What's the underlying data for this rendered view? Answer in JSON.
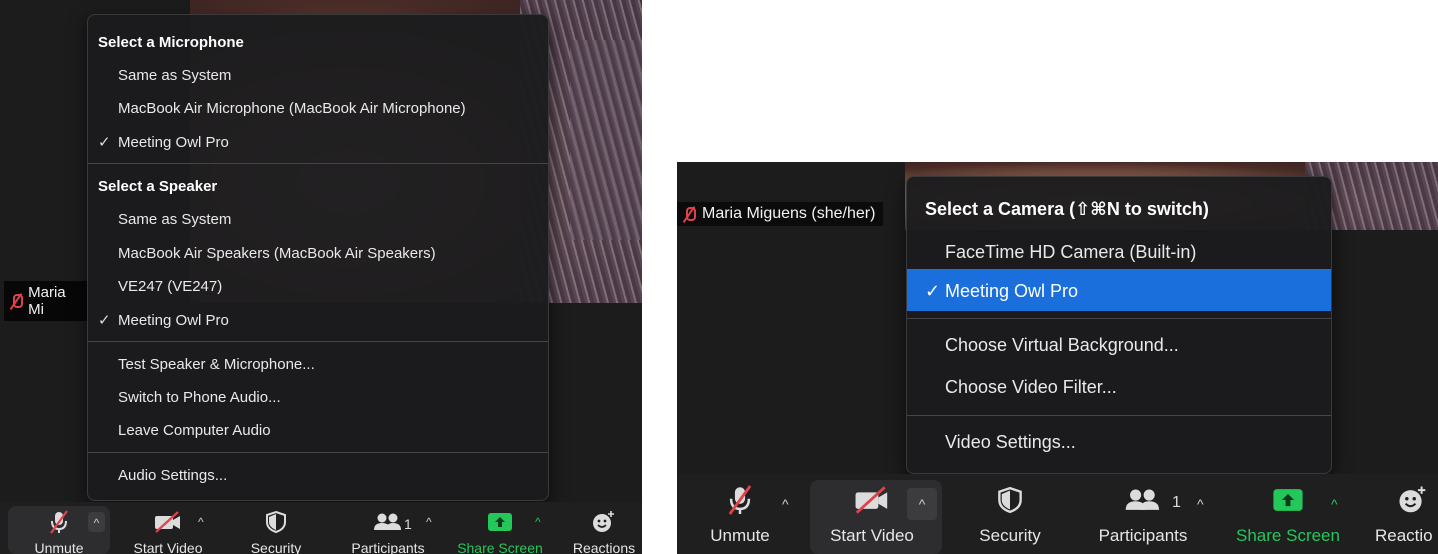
{
  "left_panel": {
    "participant_name": "Maria Mi",
    "audio_menu": {
      "microphone_header": "Select a Microphone",
      "microphones": [
        {
          "label": "Same as System",
          "checked": false
        },
        {
          "label": "MacBook Air Microphone (MacBook Air Microphone)",
          "checked": false
        },
        {
          "label": "Meeting Owl Pro",
          "checked": true
        }
      ],
      "speaker_header": "Select a Speaker",
      "speakers": [
        {
          "label": "Same as System",
          "checked": false
        },
        {
          "label": "MacBook Air Speakers (MacBook Air Speakers)",
          "checked": false
        },
        {
          "label": "VE247 (VE247)",
          "checked": false
        },
        {
          "label": "Meeting Owl Pro",
          "checked": true
        }
      ],
      "actions": [
        "Test Speaker & Microphone...",
        "Switch to Phone Audio...",
        "Leave Computer Audio"
      ],
      "settings": "Audio Settings...",
      "check_mark": "✓"
    },
    "toolbar": {
      "unmute": "Unmute",
      "start_video": "Start Video",
      "security": "Security",
      "participants": "Participants",
      "participants_count": "1",
      "share_screen": "Share Screen",
      "reactions": "Reactions"
    }
  },
  "right_panel": {
    "participant_name": "Maria Miguens (she/her)",
    "camera_menu": {
      "header": "Select a Camera (⇧⌘N to switch)",
      "cameras": [
        {
          "label": "FaceTime HD Camera (Built-in)",
          "checked": false
        },
        {
          "label": "Meeting Owl Pro",
          "checked": true
        }
      ],
      "options": [
        "Choose Virtual Background...",
        "Choose Video Filter..."
      ],
      "settings": "Video Settings...",
      "check_mark": "✓"
    },
    "toolbar": {
      "unmute": "Unmute",
      "start_video": "Start Video",
      "security": "Security",
      "participants": "Participants",
      "participants_count": "1",
      "share_screen": "Share Screen",
      "reactions": "Reactio"
    }
  },
  "colors": {
    "selected_bg": "#1a6fdd",
    "share_green": "#24c75a",
    "muted_red": "#e0424b",
    "menu_bg": "#1c1c1e"
  },
  "caret_glyph": "^"
}
